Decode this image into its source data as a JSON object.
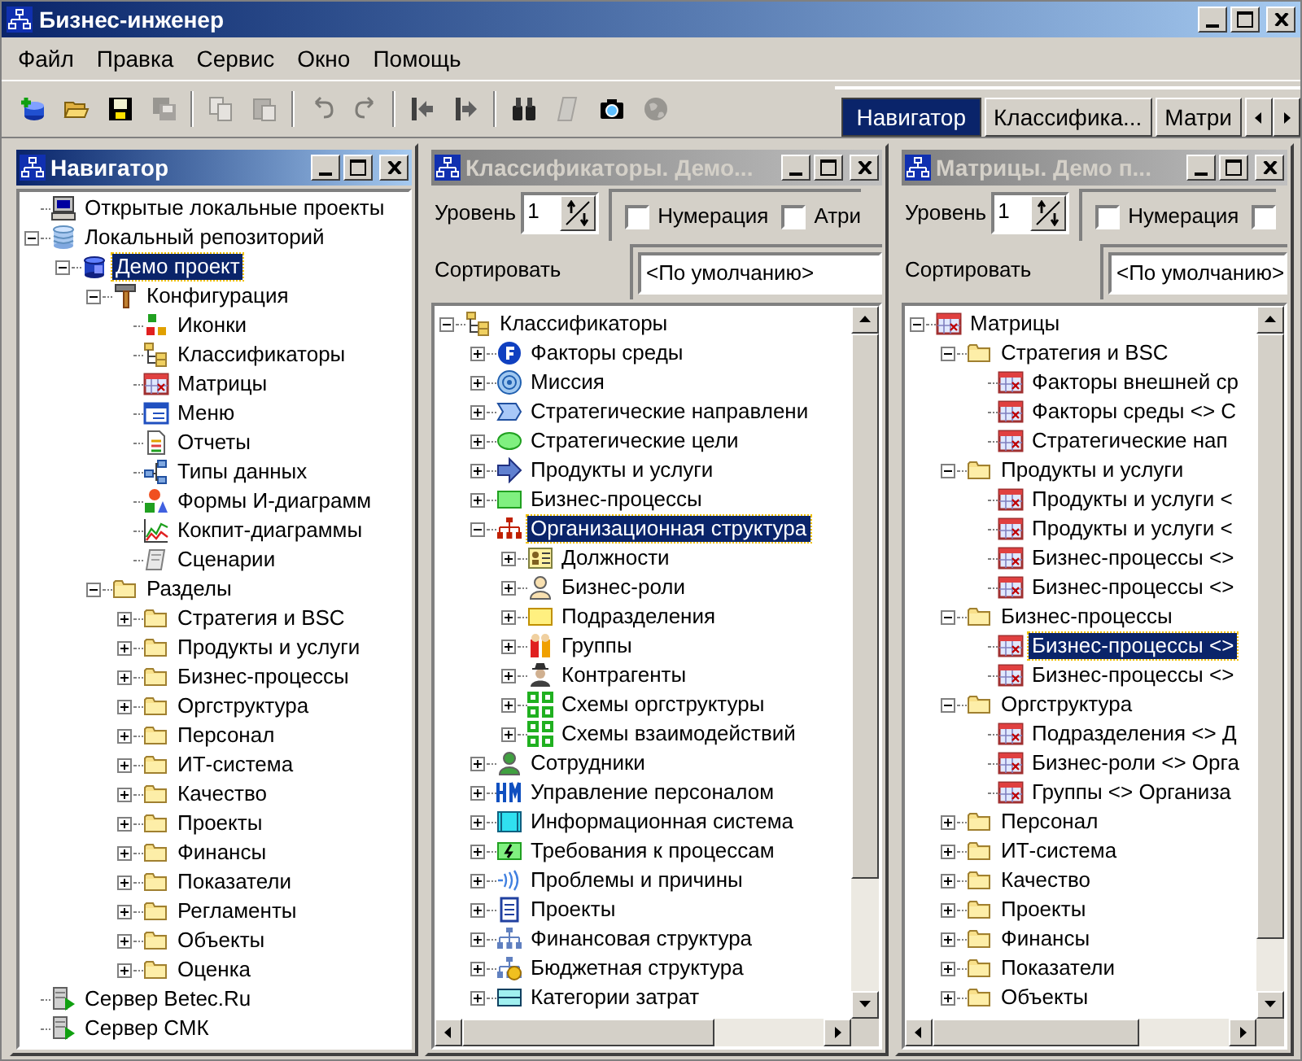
{
  "window": {
    "title": "Бизнес-инженер"
  },
  "menu": [
    "Файл",
    "Правка",
    "Сервис",
    "Окно",
    "Помощь"
  ],
  "toolbar": [
    {
      "kind": "new-db",
      "disabled": false
    },
    {
      "kind": "open",
      "disabled": false
    },
    {
      "kind": "save",
      "disabled": false
    },
    {
      "kind": "save-all",
      "disabled": true
    },
    {
      "kind": "separator"
    },
    {
      "kind": "copy",
      "disabled": true
    },
    {
      "kind": "paste",
      "disabled": true
    },
    {
      "kind": "separator"
    },
    {
      "kind": "undo",
      "disabled": true
    },
    {
      "kind": "redo",
      "disabled": true
    },
    {
      "kind": "separator"
    },
    {
      "kind": "step-left",
      "disabled": false
    },
    {
      "kind": "step-right",
      "disabled": false
    },
    {
      "kind": "separator"
    },
    {
      "kind": "binoculars",
      "disabled": false
    },
    {
      "kind": "scroll",
      "disabled": true
    },
    {
      "kind": "camera",
      "disabled": false
    },
    {
      "kind": "globe",
      "disabled": true
    }
  ],
  "tabs": [
    {
      "label": "Навигатор",
      "selected": true
    },
    {
      "label": "Классифика...",
      "selected": false
    },
    {
      "label": "Матри",
      "selected": false
    }
  ],
  "navigator": {
    "title": "Навигатор",
    "active": true,
    "tree": [
      {
        "label": "Открытые локальные проекты",
        "kind": "computer",
        "selected": false
      },
      {
        "label": "Локальный репозиторий",
        "kind": "database",
        "selected": false,
        "expanded": true,
        "children": [
          {
            "label": "Демо проект",
            "kind": "project",
            "selected": true,
            "expanded": true,
            "children": [
              {
                "label": "Конфигурация",
                "kind": "hammer",
                "selected": false,
                "expanded": true,
                "children": [
                  {
                    "label": "Иконки",
                    "kind": "icons",
                    "selected": false
                  },
                  {
                    "label": "Классификаторы",
                    "kind": "classifier",
                    "selected": false
                  },
                  {
                    "label": "Матрицы",
                    "kind": "matrix",
                    "selected": false
                  },
                  {
                    "label": "Меню",
                    "kind": "menu",
                    "selected": false
                  },
                  {
                    "label": "Отчеты",
                    "kind": "report",
                    "selected": false
                  },
                  {
                    "label": "Типы данных",
                    "kind": "datatypes",
                    "selected": false
                  },
                  {
                    "label": "Формы И-диаграмм",
                    "kind": "shapes",
                    "selected": false
                  },
                  {
                    "label": "Кокпит-диаграммы",
                    "kind": "chart",
                    "selected": false
                  },
                  {
                    "label": "Сценарии",
                    "kind": "scenario",
                    "selected": false
                  }
                ]
              },
              {
                "label": "Разделы",
                "kind": "folder",
                "selected": false,
                "expanded": true,
                "children": [
                  {
                    "label": "Стратегия и BSC",
                    "kind": "folder",
                    "selected": false,
                    "expanded": false
                  },
                  {
                    "label": "Продукты и услуги",
                    "kind": "folder",
                    "selected": false,
                    "expanded": false
                  },
                  {
                    "label": "Бизнес-процессы",
                    "kind": "folder",
                    "selected": false,
                    "expanded": false
                  },
                  {
                    "label": "Оргструктура",
                    "kind": "folder",
                    "selected": false,
                    "expanded": false
                  },
                  {
                    "label": "Персонал",
                    "kind": "folder",
                    "selected": false,
                    "expanded": false
                  },
                  {
                    "label": "ИТ-система",
                    "kind": "folder",
                    "selected": false,
                    "expanded": false
                  },
                  {
                    "label": "Качество",
                    "kind": "folder",
                    "selected": false,
                    "expanded": false
                  },
                  {
                    "label": "Проекты",
                    "kind": "folder",
                    "selected": false,
                    "expanded": false
                  },
                  {
                    "label": "Финансы",
                    "kind": "folder",
                    "selected": false,
                    "expanded": false
                  },
                  {
                    "label": "Показатели",
                    "kind": "folder",
                    "selected": false,
                    "expanded": false
                  },
                  {
                    "label": "Регламенты",
                    "kind": "folder",
                    "selected": false,
                    "expanded": false
                  },
                  {
                    "label": "Объекты",
                    "kind": "folder",
                    "selected": false,
                    "expanded": false
                  },
                  {
                    "label": "Оценка",
                    "kind": "folder",
                    "selected": false,
                    "expanded": false
                  }
                ]
              }
            ]
          }
        ]
      },
      {
        "label": "Сервер Betec.Ru",
        "kind": "server",
        "selected": false
      },
      {
        "label": "Сервер СМК",
        "kind": "server",
        "selected": false
      }
    ]
  },
  "classifiers": {
    "title": "Классификаторы. Демо...",
    "active": false,
    "level_label": "Уровень",
    "level_value": "1",
    "checkboxes": [
      {
        "label": "Нумерация",
        "checked": false
      },
      {
        "label": "Атри",
        "checked": false
      }
    ],
    "sort_label": "Сортировать",
    "sort_value": "<По умолчанию>",
    "tree": [
      {
        "label": "Классификаторы",
        "kind": "classifier",
        "selected": false,
        "expanded": true,
        "children": [
          {
            "label": "Факторы среды",
            "kind": "fcircle",
            "selected": false,
            "expanded": false
          },
          {
            "label": "Миссия",
            "kind": "target",
            "selected": false,
            "expanded": false
          },
          {
            "label": "Стратегические направлени",
            "kind": "chevron",
            "selected": false,
            "expanded": false
          },
          {
            "label": "Стратегические цели",
            "kind": "ellipse",
            "selected": false,
            "expanded": false
          },
          {
            "label": "Продукты и услуги",
            "kind": "arrow",
            "selected": false,
            "expanded": false
          },
          {
            "label": "Бизнес-процессы",
            "kind": "greenrect",
            "selected": false,
            "expanded": false
          },
          {
            "label": "Организационная структура",
            "kind": "orgchart",
            "selected": true,
            "expanded": true,
            "children": [
              {
                "label": "Должности",
                "kind": "badge",
                "selected": false,
                "expanded": false
              },
              {
                "label": "Бизнес-роли",
                "kind": "role",
                "selected": false,
                "expanded": false
              },
              {
                "label": "Подразделения",
                "kind": "yellowrect",
                "selected": false,
                "expanded": false
              },
              {
                "label": "Группы",
                "kind": "group",
                "selected": false,
                "expanded": false
              },
              {
                "label": "Контрагенты",
                "kind": "agent",
                "selected": false,
                "expanded": false
              },
              {
                "label": "Схемы оргструктуры",
                "kind": "scheme",
                "selected": false,
                "expanded": false
              },
              {
                "label": "Схемы взаимодействий",
                "kind": "scheme",
                "selected": false,
                "expanded": false
              }
            ]
          },
          {
            "label": "Сотрудники",
            "kind": "employee",
            "selected": false,
            "expanded": false
          },
          {
            "label": "Управление персоналом",
            "kind": "hm",
            "selected": false,
            "expanded": false
          },
          {
            "label": "Информационная система",
            "kind": "infosys",
            "selected": false,
            "expanded": false
          },
          {
            "label": "Требования к процессам",
            "kind": "bolt",
            "selected": false,
            "expanded": false
          },
          {
            "label": "Проблемы и причины",
            "kind": "waves",
            "selected": false,
            "expanded": false
          },
          {
            "label": "Проекты",
            "kind": "list",
            "selected": false,
            "expanded": false
          },
          {
            "label": "Финансовая структура",
            "kind": "fin",
            "selected": false,
            "expanded": false
          },
          {
            "label": "Бюджетная структура",
            "kind": "budget",
            "selected": false,
            "expanded": false
          },
          {
            "label": "Категории затрат",
            "kind": "cost",
            "selected": false,
            "expanded": false
          }
        ]
      }
    ]
  },
  "matrices": {
    "title": "Матрицы. Демо п...",
    "active": false,
    "level_label": "Уровень",
    "level_value": "1",
    "checkboxes": [
      {
        "label": "Нумерация",
        "checked": false
      },
      {
        "checked": false
      }
    ],
    "sort_label": "Сортировать",
    "sort_value": "<По умолчанию>",
    "tree": [
      {
        "label": "Матрицы",
        "kind": "matrix",
        "selected": false,
        "expanded": true,
        "children": [
          {
            "label": "Стратегия и BSC",
            "kind": "folder",
            "selected": false,
            "expanded": true,
            "children": [
              {
                "label": "Факторы внешней ср",
                "kind": "matrix",
                "selected": false
              },
              {
                "label": "Факторы среды <> С",
                "kind": "matrix",
                "selected": false
              },
              {
                "label": "Стратегические нап",
                "kind": "matrix",
                "selected": false
              }
            ]
          },
          {
            "label": "Продукты и услуги",
            "kind": "folder",
            "selected": false,
            "expanded": true,
            "children": [
              {
                "label": "Продукты и услуги <",
                "kind": "matrix",
                "selected": false
              },
              {
                "label": "Продукты и услуги <",
                "kind": "matrix",
                "selected": false
              },
              {
                "label": "Бизнес-процессы <>",
                "kind": "matrix",
                "selected": false
              },
              {
                "label": "Бизнес-процессы <>",
                "kind": "matrix",
                "selected": false
              }
            ]
          },
          {
            "label": "Бизнес-процессы",
            "kind": "folder",
            "selected": false,
            "expanded": true,
            "children": [
              {
                "label": "Бизнес-процессы <>",
                "kind": "matrix",
                "selected": true
              },
              {
                "label": "Бизнес-процессы <>",
                "kind": "matrix",
                "selected": false
              }
            ]
          },
          {
            "label": "Оргструктура",
            "kind": "folder",
            "selected": false,
            "expanded": true,
            "children": [
              {
                "label": "Подразделения <> Д",
                "kind": "matrix",
                "selected": false
              },
              {
                "label": "Бизнес-роли <> Орга",
                "kind": "matrix",
                "selected": false
              },
              {
                "label": "Группы <> Организа",
                "kind": "matrix",
                "selected": false
              }
            ]
          },
          {
            "label": "Персонал",
            "kind": "folder",
            "selected": false,
            "expanded": false
          },
          {
            "label": "ИТ-система",
            "kind": "folder",
            "selected": false,
            "expanded": false
          },
          {
            "label": "Качество",
            "kind": "folder",
            "selected": false,
            "expanded": false
          },
          {
            "label": "Проекты",
            "kind": "folder",
            "selected": false,
            "expanded": false
          },
          {
            "label": "Финансы",
            "kind": "folder",
            "selected": false,
            "expanded": false
          },
          {
            "label": "Показатели",
            "kind": "folder",
            "selected": false,
            "expanded": false
          },
          {
            "label": "Объекты",
            "kind": "folder",
            "selected": false,
            "expanded": false
          }
        ]
      }
    ]
  }
}
